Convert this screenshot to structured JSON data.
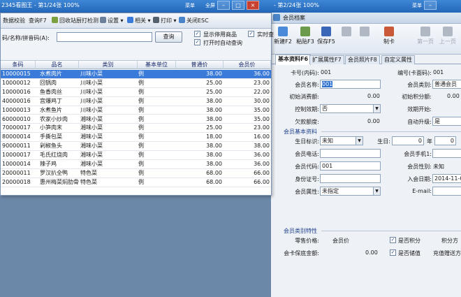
{
  "bg_title": "2345看图王 - 第1/24张 100%",
  "bg_title_right": "- 第2/24张 100%",
  "bg_controls": [
    "菜单",
    "全屏"
  ],
  "member": {
    "title": "会员档案",
    "toolbar": [
      {
        "label": "新建F2",
        "color": "#4a8ad8",
        "disabled": false
      },
      {
        "label": "粘贴F3",
        "color": "#6a9a4a",
        "disabled": false
      },
      {
        "label": "保存F5",
        "color": "#3a66b8",
        "disabled": false
      },
      {
        "label": "",
        "color": "#b0b8c4",
        "disabled": true
      },
      {
        "label": "",
        "color": "#b0b8c4",
        "disabled": true
      },
      {
        "label": "制卡",
        "color": "#c85a3a",
        "disabled": false
      },
      {
        "label": "第一页",
        "color": "#b0b8c4",
        "disabled": true
      },
      {
        "label": "上一页",
        "color": "#b0b8c4",
        "disabled": true
      }
    ],
    "tabs": [
      "基本资料F6",
      "扩展属性F7",
      "会员照片F8",
      "自定义属性"
    ],
    "fields": {
      "card_no_label": "卡号(内码):",
      "card_no": "001",
      "code_label": "编号(卡面码):",
      "code": "001",
      "name_label": "会员名称:",
      "name": "001",
      "type_label": "会员类别:",
      "type": "普通会员",
      "init_spend_label": "初始消费额:",
      "init_spend": "0.00",
      "init_points_label": "初始积分额:",
      "init_points": "0.00",
      "expiry_ctrl_label": "控制效期:",
      "expiry_ctrl": "否",
      "valid_start_label": "效期开始:",
      "credit_label": "欠款额度:",
      "credit": "0.00",
      "auto_upgrade_label": "自动升级:",
      "auto_upgrade": "是"
    },
    "basic_section": "会员基本资料",
    "basic": {
      "birth_flag_label": "生日标识:",
      "birth_flag": "未知",
      "birthday_label": "生日:",
      "birthday_val": "0",
      "year_label": "年",
      "month_val": "0",
      "phone_label": "会员电话:",
      "mobile_label": "会员手机1:",
      "id_label": "会员代码:",
      "id": "001",
      "gender_label": "会员性别:",
      "gender": "未知",
      "idcard_label": "身份证号:",
      "join_label": "入会日期:",
      "join": "2014-11-01",
      "attr_label": "会员属性:",
      "attr": "未指定",
      "email_label": "E-mail:"
    },
    "type_section": "会员类别特性",
    "typeinfo": {
      "price_label": "零售价格:",
      "price": "会员价",
      "points_cb_label": "是否积分",
      "points_method_label": "积分方",
      "deposit_label": "会卡保底金额:",
      "deposit": "0.00",
      "stored_cb_label": "是否储值",
      "recharge_label": "充值赠送方"
    }
  },
  "picker": {
    "toolbar": [
      "数据校验",
      "查询F7",
      "回收站",
      "厨打检测",
      "设置",
      "相关",
      "打印",
      "关闭ESC"
    ],
    "search_label": "码/名称/拼音码(A):",
    "search_value": "",
    "query_btn": "查询",
    "opt_show_disabled": "显示停用商品",
    "opt_realtime": "实时查",
    "opt_auto_query": "打开时自动查询",
    "columns": [
      "条码",
      "品名",
      "类别",
      "基本单位",
      "普通价",
      "会员价"
    ],
    "rows": [
      [
        "10000015",
        "水煮肉片",
        "川味小菜",
        "例",
        "38.00",
        "36.00"
      ],
      [
        "10000012",
        "回锅肉",
        "川味小菜",
        "例",
        "25.00",
        "23.00"
      ],
      [
        "10000016",
        "鱼香肉丝",
        "川味小菜",
        "例",
        "25.00",
        "22.00"
      ],
      [
        "40000016",
        "宫爆鸡丁",
        "川味小菜",
        "例",
        "38.00",
        "30.00"
      ],
      [
        "10000013",
        "水煮鱼片",
        "川味小菜",
        "例",
        "38.00",
        "35.00"
      ],
      [
        "60000010",
        "农家小炒肉",
        "湘味小菜",
        "例",
        "38.00",
        "35.00"
      ],
      [
        "70000017",
        "小笋肉末",
        "湘味小菜",
        "例",
        "25.00",
        "23.00"
      ],
      [
        "80000014",
        "手撕包菜",
        "湘味小菜",
        "例",
        "18.00",
        "16.00"
      ],
      [
        "90000011",
        "剁椒鱼头",
        "湘味小菜",
        "例",
        "38.00",
        "38.00"
      ],
      [
        "10000017",
        "毛氏红烧肉",
        "湘味小菜",
        "例",
        "38.00",
        "36.00"
      ],
      [
        "10000014",
        "辣子鸡",
        "湘味小菜",
        "例",
        "38.00",
        "36.00"
      ],
      [
        "20000011",
        "罗汉扒全鸭",
        "特色菜",
        "例",
        "68.00",
        "66.00"
      ],
      [
        "20000018",
        "惠州梅菜焖肋骨",
        "特色菜",
        "例",
        "68.00",
        "66.00"
      ]
    ]
  }
}
